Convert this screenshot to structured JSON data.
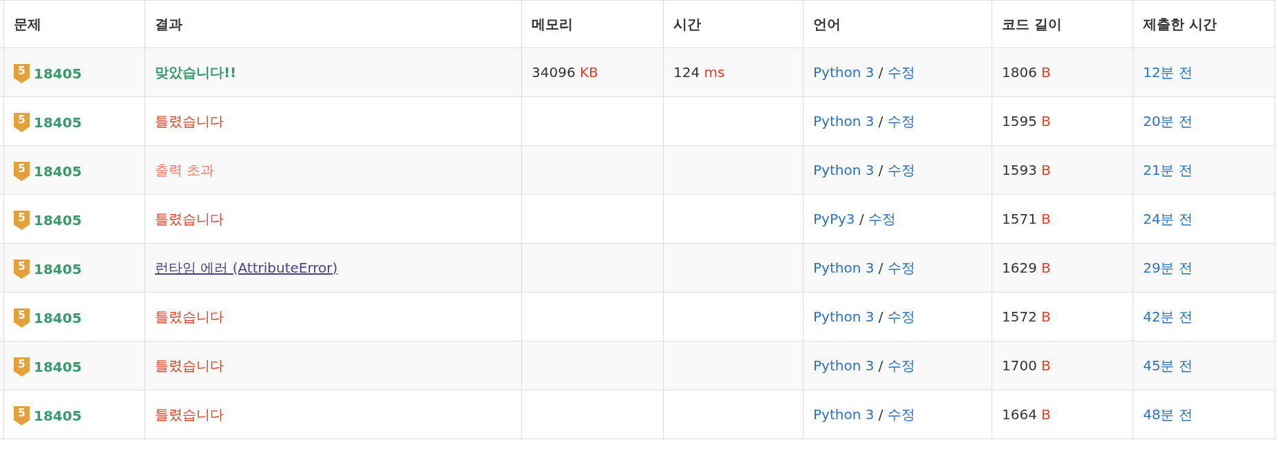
{
  "table": {
    "columns": [
      "문제",
      "결과",
      "메모리",
      "시간",
      "언어",
      "코드 길이",
      "제출한 시간"
    ],
    "rows": [
      {
        "tier": "5",
        "problem": "18405",
        "result": {
          "text": "맞았습니다!!",
          "kind": "accepted"
        },
        "memory": "34096",
        "memory_unit": "KB",
        "time": "124",
        "time_unit": "ms",
        "language": {
          "name": "Python 3",
          "separator": "/",
          "edit": "수정"
        },
        "code_length": "1806",
        "code_unit": "B",
        "submitted": "12분 전"
      },
      {
        "tier": "5",
        "problem": "18405",
        "result": {
          "text": "틀렸습니다",
          "kind": "wrong"
        },
        "language": {
          "name": "Python 3",
          "separator": "/",
          "edit": "수정"
        },
        "code_length": "1595",
        "code_unit": "B",
        "submitted": "20분 전"
      },
      {
        "tier": "5",
        "problem": "18405",
        "result": {
          "text": "출력 초과",
          "kind": "output_exceeded"
        },
        "language": {
          "name": "Python 3",
          "separator": "/",
          "edit": "수정"
        },
        "code_length": "1593",
        "code_unit": "B",
        "submitted": "21분 전"
      },
      {
        "tier": "5",
        "problem": "18405",
        "result": {
          "text": "틀렸습니다",
          "kind": "wrong"
        },
        "language": {
          "name": "PyPy3",
          "separator": "/",
          "edit": "수정"
        },
        "code_length": "1571",
        "code_unit": "B",
        "submitted": "24분 전"
      },
      {
        "tier": "5",
        "problem": "18405",
        "result": {
          "text": "런타임 에러 (AttributeError)",
          "kind": "runtime_error"
        },
        "language": {
          "name": "Python 3",
          "separator": "/",
          "edit": "수정"
        },
        "code_length": "1629",
        "code_unit": "B",
        "submitted": "29분 전"
      },
      {
        "tier": "5",
        "problem": "18405",
        "result": {
          "text": "틀렸습니다",
          "kind": "wrong"
        },
        "language": {
          "name": "Python 3",
          "separator": "/",
          "edit": "수정"
        },
        "code_length": "1572",
        "code_unit": "B",
        "submitted": "42분 전"
      },
      {
        "tier": "5",
        "problem": "18405",
        "result": {
          "text": "틀렸습니다",
          "kind": "wrong"
        },
        "language": {
          "name": "Python 3",
          "separator": "/",
          "edit": "수정"
        },
        "code_length": "1700",
        "code_unit": "B",
        "submitted": "45분 전"
      },
      {
        "tier": "5",
        "problem": "18405",
        "result": {
          "text": "틀렸습니다",
          "kind": "wrong"
        },
        "language": {
          "name": "Python 3",
          "separator": "/",
          "edit": "수정"
        },
        "code_length": "1664",
        "code_unit": "B",
        "submitted": "48분 전"
      }
    ]
  }
}
